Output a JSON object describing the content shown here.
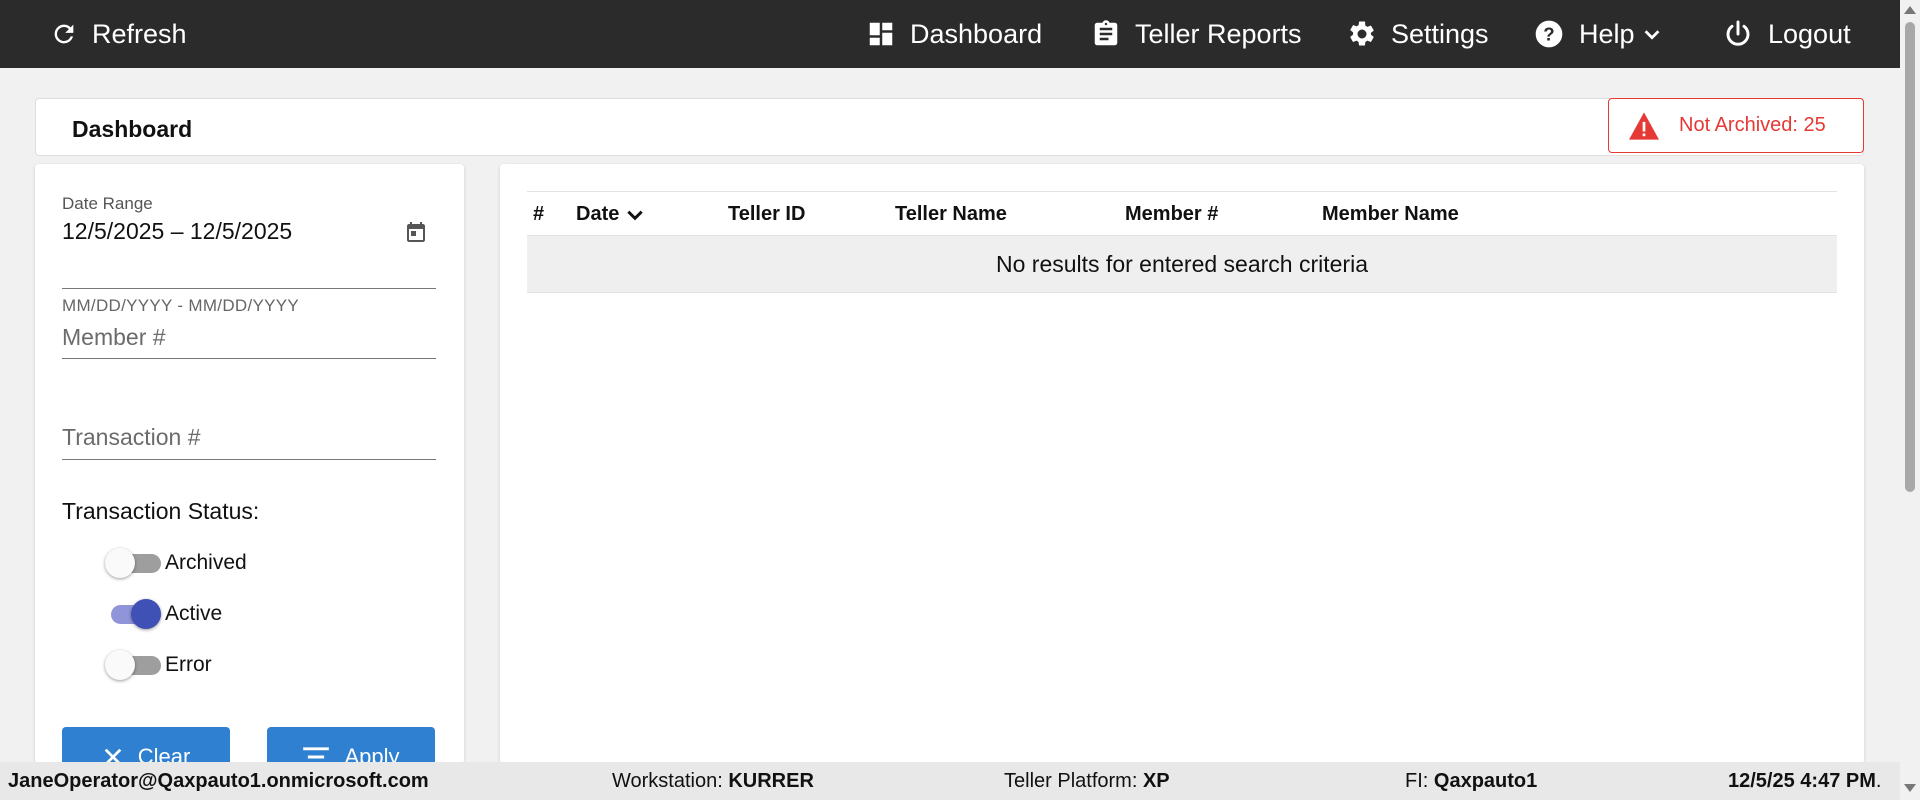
{
  "nav": {
    "refresh_label": "Refresh",
    "dashboard_label": "Dashboard",
    "teller_reports_label": "Teller Reports",
    "settings_label": "Settings",
    "help_label": "Help",
    "logout_label": "Logout"
  },
  "header": {
    "title": "Dashboard",
    "alert_text": "Not Archived: 25",
    "alert_color": "#e53935"
  },
  "filters": {
    "date_range_label": "Date Range",
    "date_range_value": "12/5/2025 – 12/5/2025",
    "date_range_hint": "MM/DD/YYYY - MM/DD/YYYY",
    "member_placeholder": "Member #",
    "transaction_placeholder": "Transaction #",
    "status_heading": "Transaction Status:",
    "toggles": [
      {
        "label": "Archived",
        "on": false
      },
      {
        "label": "Active",
        "on": true
      },
      {
        "label": "Error",
        "on": false
      }
    ],
    "clear_label": "Clear",
    "apply_label": "Apply"
  },
  "table": {
    "columns": [
      "#",
      "Date",
      "Teller ID",
      "Teller Name",
      "Member #",
      "Member Name"
    ],
    "sort_column": "Date",
    "empty_message": "No results for entered search criteria"
  },
  "footer": {
    "user": "JaneOperator@Qaxpauto1.onmicrosoft.com",
    "workstation_label": "Workstation:",
    "workstation_value": "KURRER",
    "platform_label": "Teller Platform:",
    "platform_value": "XP",
    "fi_label": "FI:",
    "fi_value": "Qaxpauto1",
    "datetime": "12/5/25 4:47 PM",
    "datetime_suffix": "."
  },
  "colors": {
    "topbar": "#2b2b2b",
    "accent_button": "#2f80d1",
    "toggle_on": "#3f51b5"
  }
}
